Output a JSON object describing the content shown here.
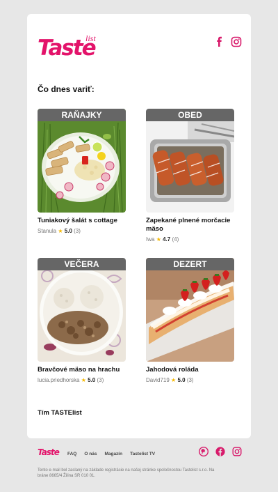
{
  "header": {
    "logo_text": "Taste",
    "logo_sub": "list",
    "social": [
      "facebook-icon",
      "instagram-icon"
    ]
  },
  "heading": "Čo dnes variť:",
  "recipes": [
    {
      "category": "RAŇAJKY",
      "title": "Tuniakový šalát s cottage",
      "author": "Stanula",
      "rating": "5.0",
      "count": "(3)"
    },
    {
      "category": "OBED",
      "title": "Zapekané plnené morčacie mäso",
      "author": "Iwa",
      "rating": "4.7",
      "count": "(4)"
    },
    {
      "category": "VEČERA",
      "title": "Bravčové mäso na hrachu",
      "author": "lucia.priedhorska",
      "rating": "5.0",
      "count": "(3)"
    },
    {
      "category": "DEZERT",
      "title": "Jahodová roláda",
      "author": "David719",
      "rating": "5.0",
      "count": "(3)"
    }
  ],
  "signature": "Tím TASTElist",
  "footer": {
    "logo_text": "Taste",
    "links": [
      "FAQ",
      "O nás",
      "Magazín",
      "Tastelist TV"
    ],
    "social": [
      "pinterest-icon",
      "facebook-icon",
      "instagram-icon"
    ],
    "disclaimer": "Tento e-mail bol zaslaný na základe registrácie na našej stránke spoločnostou Tastelist s.r.o. Na bráne 8665/4 Žilina SR 010 01."
  },
  "colors": {
    "brand": "#e3136a",
    "background": "#e7e7e7",
    "category_bar": "#666666",
    "star": "#f5b800"
  }
}
